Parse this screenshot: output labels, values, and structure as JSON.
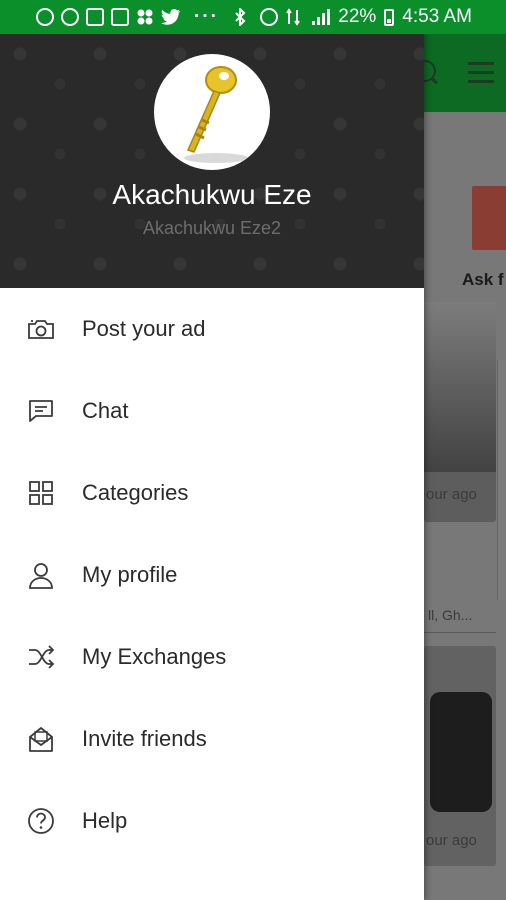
{
  "status_bar": {
    "battery": "22%",
    "time": "4:53 AM",
    "overflow": "···",
    "icons": [
      "whatsapp-icon",
      "alarm-icon",
      "image-icon",
      "image-icon",
      "grid-icon",
      "twitter-icon",
      "bluetooth-icon",
      "alarm-icon",
      "data-icon",
      "signal-icon",
      "battery-icon"
    ]
  },
  "drawer": {
    "user": {
      "name": "Akachukwu Eze",
      "handle": "Akachukwu Eze2"
    },
    "menu": [
      {
        "label": "Post your ad",
        "icon": "camera-icon"
      },
      {
        "label": "Chat",
        "icon": "chat-icon"
      },
      {
        "label": "Categories",
        "icon": "categories-icon"
      },
      {
        "label": "My profile",
        "icon": "profile-icon"
      },
      {
        "label": "My Exchanges",
        "icon": "exchange-icon"
      },
      {
        "label": "Invite friends",
        "icon": "invite-icon"
      },
      {
        "label": "Help",
        "icon": "help-icon"
      }
    ]
  },
  "background": {
    "ask_label": "Ask f",
    "time_text": "our ago",
    "location_text": "ll, Gh...",
    "time_text_2": "our ago",
    "ellipsis": "..."
  },
  "colors": {
    "status_bar": "#0a8f2b",
    "toolbar": "#0c6a23",
    "drawer_header": "#2a2a2a",
    "menu_text": "#2a2a2a"
  }
}
